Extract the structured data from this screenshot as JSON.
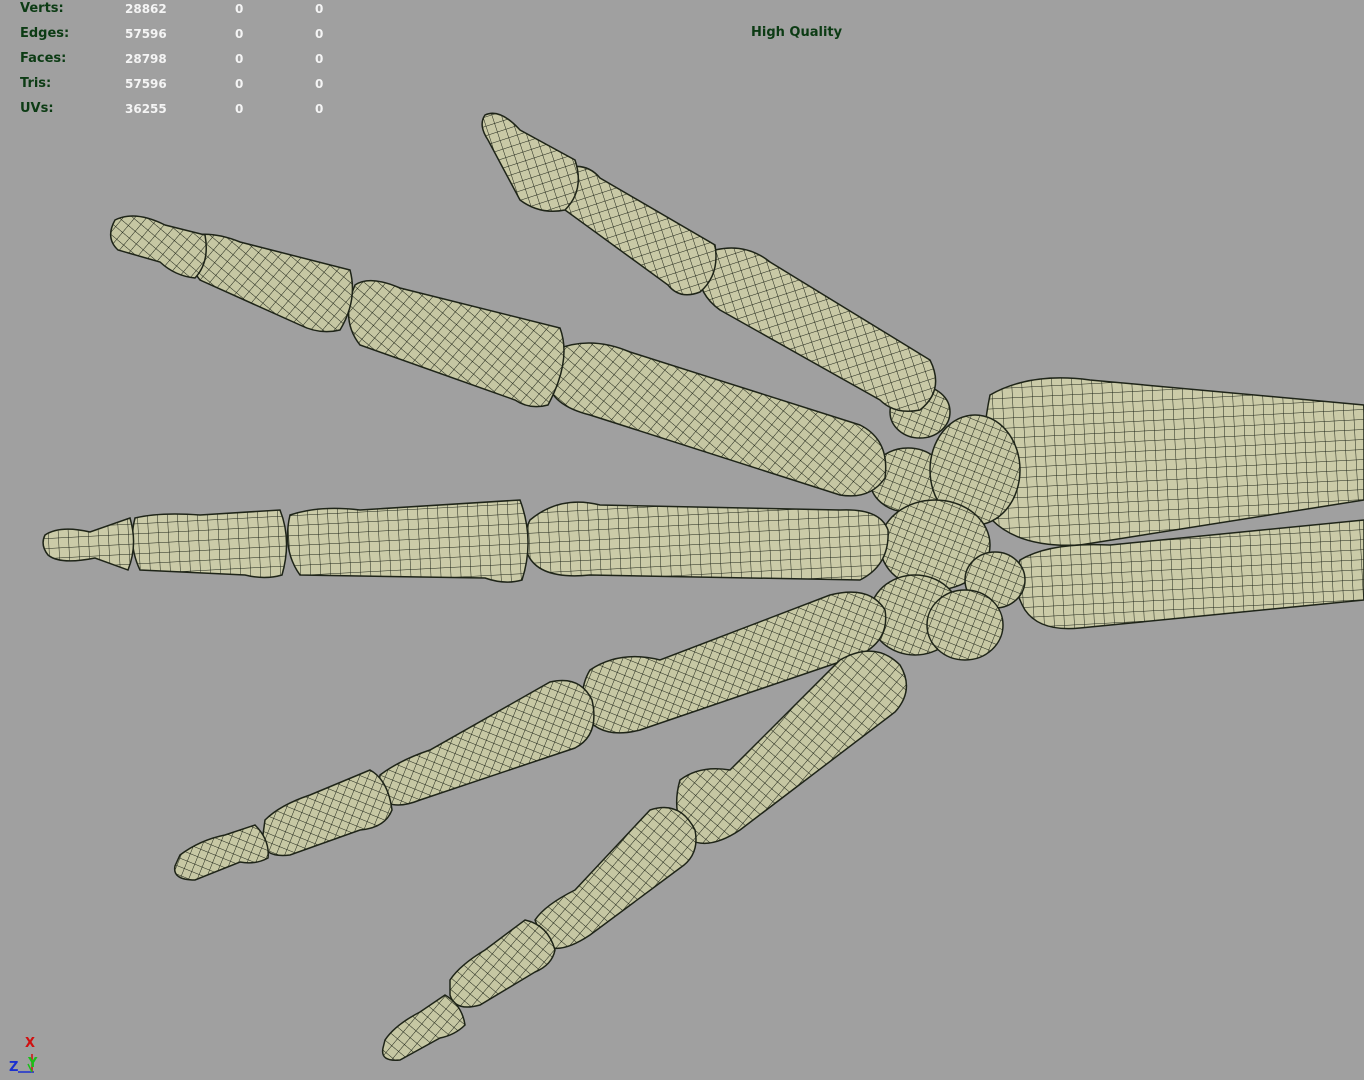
{
  "viewport": {
    "background_color": "#a0a0a0",
    "bone_color": "#c9c9a6",
    "wire_color": "#1e2418",
    "hud_label_color": "#0c3b14",
    "hud_value_color": "#f4f4f4"
  },
  "hud": {
    "rows": [
      {
        "label": "Verts:",
        "v1": "28862",
        "v2": "0",
        "v3": "0"
      },
      {
        "label": "Edges:",
        "v1": "57596",
        "v2": "0",
        "v3": "0"
      },
      {
        "label": "Faces:",
        "v1": "28798",
        "v2": "0",
        "v3": "0"
      },
      {
        "label": "Tris:",
        "v1": "57596",
        "v2": "0",
        "v3": "0"
      },
      {
        "label": "UVs:",
        "v1": "36255",
        "v2": "0",
        "v3": "0"
      }
    ],
    "quality": "High Quality"
  },
  "axis_gizmo": {
    "x_label": "X",
    "y_label": "Y",
    "z_label": "Z",
    "x_color": "#d01010",
    "y_color": "#18c018",
    "z_color": "#1a2fd0"
  }
}
